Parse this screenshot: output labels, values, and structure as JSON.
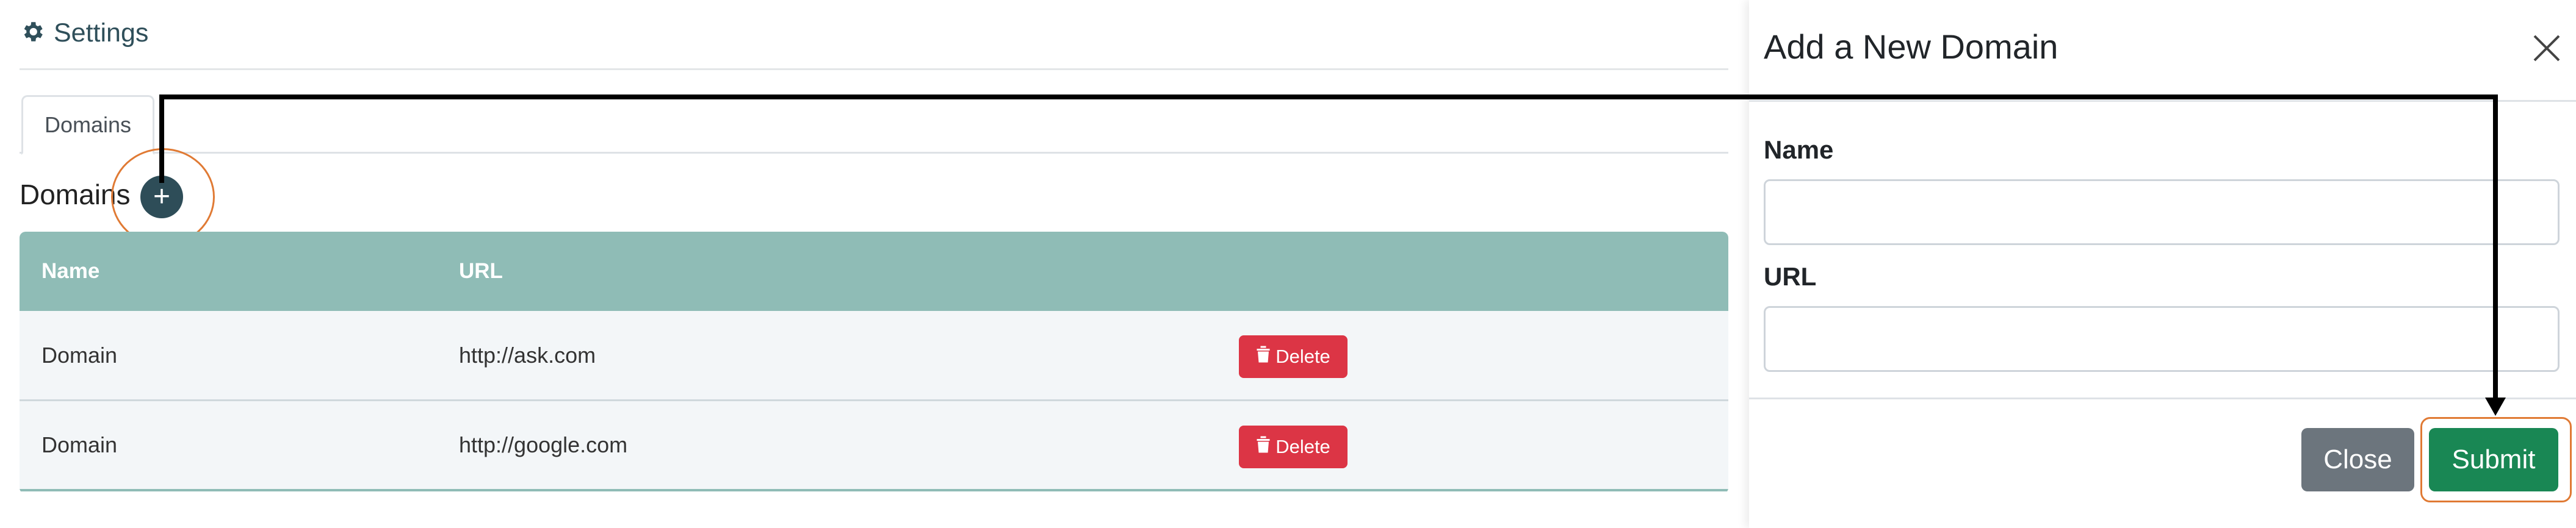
{
  "header": {
    "title": "Settings",
    "icon": "gear-icon"
  },
  "tabs": [
    {
      "label": "Domains"
    }
  ],
  "section": {
    "title": "Domains",
    "add_icon": "plus-icon"
  },
  "table": {
    "columns": [
      "Name",
      "URL"
    ],
    "rows": [
      {
        "name": "Domain",
        "url": "http://ask.com",
        "action": "Delete"
      },
      {
        "name": "Domain",
        "url": "http://google.com",
        "action": "Delete"
      }
    ]
  },
  "modal": {
    "title": "Add a New Domain",
    "fields": [
      {
        "label": "Name",
        "value": ""
      },
      {
        "label": "URL",
        "value": ""
      }
    ],
    "close_label": "Close",
    "submit_label": "Submit"
  },
  "colors": {
    "table_header": "#8fbcb6",
    "delete": "#dc3545",
    "submit": "#198754",
    "close": "#6c757d",
    "highlight": "#e07a34",
    "add_button": "#2e4d58"
  }
}
